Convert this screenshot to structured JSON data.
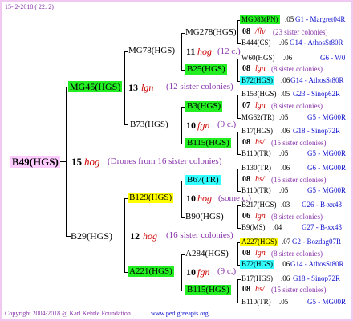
{
  "header": {
    "date": "15- 2-2018 ( 22: 2)"
  },
  "footer": {
    "copyright": "Copyright 2004-2018 @ Karl Kehrle Foundation.",
    "website": "www.pedigreeapis.org"
  },
  "root": {
    "name": "B49(HGS)",
    "year": "15",
    "code": "hog",
    "note": "(Drones from 16 sister colonies)"
  },
  "g1": {
    "top": {
      "name": "MG45(HGS)",
      "year": "13",
      "code": "lgn",
      "note": "(12 sister colonies)"
    },
    "bottom": {
      "name": "B29(HGS)",
      "year": "12",
      "code": "hog",
      "note": "(16 sister colonies)"
    }
  },
  "g2": {
    "a": {
      "name": "MG78(HGS)",
      "year": "11",
      "code": "hog",
      "note": "(12 c.)"
    },
    "b": {
      "name": "B73(HGS)",
      "year": "10",
      "code": "fgn",
      "note": "(9 c.)"
    },
    "c": {
      "name": "B129(HGS)",
      "year": "10",
      "code": "hog",
      "note": "(some c.)"
    },
    "d": {
      "name": "A221(HGS)",
      "year": "10",
      "code": "fgn",
      "note": "(9 c.)"
    }
  },
  "g3": {
    "a1": {
      "name": "MG278(HGS)",
      "year": "08",
      "code": "/fh/",
      "note": "(23 sister colonies)"
    },
    "a2": {
      "name": "B25(HGS)",
      "year": "08",
      "code": "lgn",
      "note": "(8 sister colonies)"
    },
    "b1": {
      "name": "B3(HGS)",
      "year": "07",
      "code": "lgn",
      "note": "(8 sister colonies)"
    },
    "b2": {
      "name": "B115(HGS)",
      "year": "08",
      "code": "hs/",
      "note": "(15 sister colonies)"
    },
    "c1": {
      "name": "B67(TR)",
      "year": "08",
      "code": "hs/",
      "note": "(15 sister colonies)"
    },
    "c2": {
      "name": "B90(HGS)",
      "year": "06",
      "code": "lgn",
      "note": "(8 sister colonies)"
    },
    "d1": {
      "name": "A284(HGS)",
      "year": "08",
      "code": "lgn",
      "note": "(8 sister colonies)"
    },
    "d2": {
      "name": "B115(HGS)",
      "year": "08",
      "code": "hs/",
      "note": "(15 sister colonies)"
    }
  },
  "g4": [
    {
      "name": "MG083(PN)",
      "year": ".05",
      "extra": "G1 - Margret04R"
    },
    {
      "name": "B444(CS)",
      "year": ".05",
      "extra": "G14 - AthosSt80R"
    },
    {
      "name": "W60(HGS)",
      "year": ".06",
      "extra": "G6 - W0"
    },
    {
      "name": "B72(HGS)",
      "year": ".06",
      "extra": "G14 - AthosSt80R"
    },
    {
      "name": "B153(HGS)",
      "year": ".05",
      "extra": "G23 - Sinop62R"
    },
    {
      "name": "MG62(TR)",
      "year": ".05",
      "extra": "G5 - MG00R"
    },
    {
      "name": "B17(HGS)",
      "year": ".06",
      "extra": "G18 - Sinop72R"
    },
    {
      "name": "B110(TR)",
      "year": ".05",
      "extra": "G5 - MG00R"
    },
    {
      "name": "B130(TR)",
      "year": ".06",
      "extra": "G6 - MG00R"
    },
    {
      "name": "B110(TR)",
      "year": ".05",
      "extra": "G5 - MG00R"
    },
    {
      "name": "B217(HGS)",
      "year": ".03",
      "extra": "G26 - B-xx43"
    },
    {
      "name": "B9(MS)",
      "year": ".04",
      "extra": "G27 - B-xx43"
    },
    {
      "name": "A227(HGS)",
      "year": ".07",
      "extra": "G2 - Bozdag07R"
    },
    {
      "name": "B72(HGS)",
      "year": ".06",
      "extra": "G14 - AthosSt80R"
    },
    {
      "name": "B17(HGS)",
      "year": ".06",
      "extra": "G18 - Sinop72R"
    },
    {
      "name": "B110(TR)",
      "year": ".05",
      "extra": "G5 - MG00R"
    }
  ]
}
